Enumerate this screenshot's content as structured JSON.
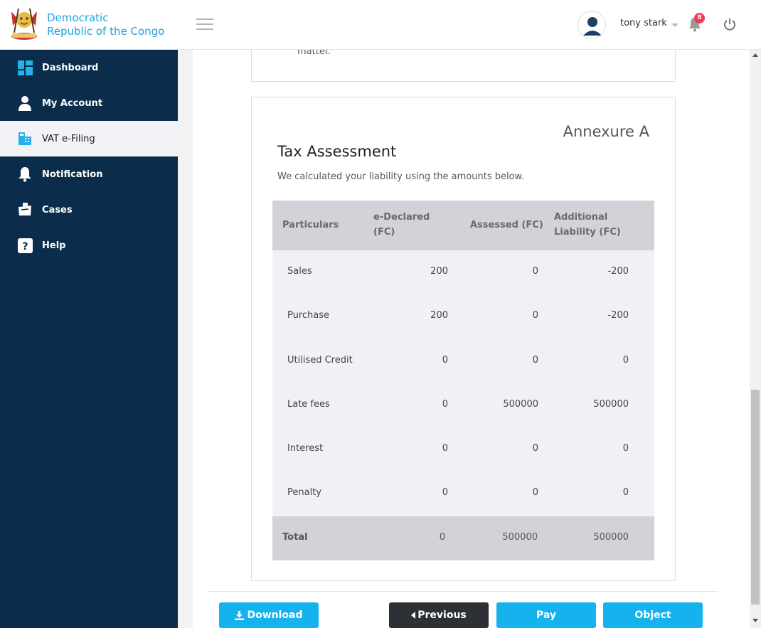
{
  "header": {
    "brand_line1": "Democratic",
    "brand_line2": "Republic of the Congo",
    "user_name": "tony stark",
    "notification_count": "8"
  },
  "sidebar": {
    "items": [
      {
        "label": "Dashboard",
        "icon": "dashboard-icon"
      },
      {
        "label": "My Account",
        "icon": "user-icon"
      },
      {
        "label": "VAT e-Filing",
        "icon": "vat-filing-icon"
      },
      {
        "label": "Notification",
        "icon": "bell-icon"
      },
      {
        "label": "Cases",
        "icon": "cases-icon"
      },
      {
        "label": "Help",
        "icon": "help-icon"
      }
    ],
    "active": "VAT e-Filing"
  },
  "main": {
    "previous_section_tail": "matter.",
    "annexure_label": "Annexure A",
    "title": "Tax Assessment",
    "subtitle": "We calculated your liability using the amounts below.",
    "table": {
      "headers": [
        "Particulars",
        "e-Declared (FC)",
        "Assessed (FC)",
        "Additional Liability (FC)"
      ],
      "rows": [
        {
          "particular": "Sales",
          "declared": "200",
          "assessed": "0",
          "additional": "-200"
        },
        {
          "particular": "Purchase",
          "declared": "200",
          "assessed": "0",
          "additional": "-200"
        },
        {
          "particular": "Utilised Credit",
          "declared": "0",
          "assessed": "0",
          "additional": "0"
        },
        {
          "particular": "Late fees",
          "declared": "0",
          "assessed": "500000",
          "additional": "500000"
        },
        {
          "particular": "Interest",
          "declared": "0",
          "assessed": "0",
          "additional": "0"
        },
        {
          "particular": "Penalty",
          "declared": "0",
          "assessed": "0",
          "additional": "0"
        }
      ],
      "total": {
        "label": "Total",
        "declared": "0",
        "assessed": "500000",
        "additional": "500000"
      }
    }
  },
  "actions": {
    "download": "Download",
    "previous": "Previous",
    "pay": "Pay",
    "object": "Object"
  },
  "colors": {
    "sidebar_bg": "#0b2d4b",
    "accent": "#16b2ee",
    "dark_button": "#2d3035",
    "badge": "#f13b52"
  }
}
